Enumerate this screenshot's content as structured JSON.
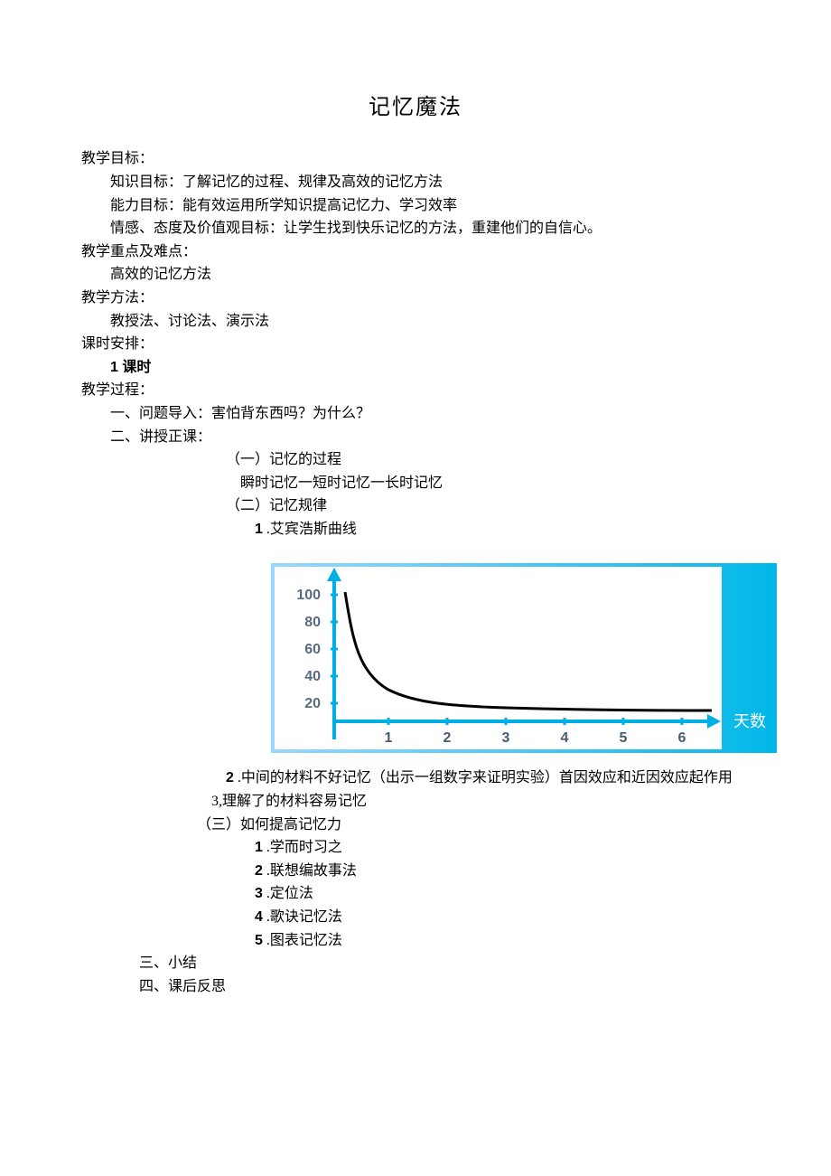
{
  "title": "记忆魔法",
  "goals_header": "教学目标：",
  "goals": {
    "knowledge": "知识目标：了解记忆的过程、规律及高效的记忆方法",
    "ability": "能力目标：能有效运用所学知识提高记忆力、学习效率",
    "emotion": "情感、态度及价值观目标：让学生找到快乐记忆的方法，重建他们的自信心。"
  },
  "focus_header": "教学重点及难点：",
  "focus_text": "高效的记忆方法",
  "method_header": "教学方法：",
  "method_text": "教授法、讨论法、演示法",
  "schedule_header": "课时安排：",
  "schedule_text": "1 课时",
  "process_header": "教学过程：",
  "sec1": "一、问题导入：害怕背东西吗？为什么？",
  "sec2": "二、讲授正课：",
  "s2_1": "（一）记忆的过程",
  "s2_1_text": "瞬时记忆一短时记忆一长时记忆",
  "s2_2": "（二）记忆规律",
  "s2_2_1_num": "1",
  "s2_2_1_text": " .艾宾浩斯曲线",
  "chart_data": {
    "type": "line",
    "title": "",
    "xlabel": "天数",
    "ylabel": "",
    "x": [
      0,
      1,
      2,
      3,
      4,
      5,
      6
    ],
    "values": [
      100,
      34,
      25,
      22,
      20,
      18,
      17
    ],
    "yticks": [
      20,
      40,
      60,
      80,
      100
    ],
    "xticks": [
      1,
      2,
      3,
      4,
      5,
      6
    ],
    "ylim": [
      0,
      110
    ]
  },
  "s2_2_2_num": "2",
  "s2_2_2_text": " .中间的材料不好记忆（出示一组数字来证明实验）首因效应和近因效应起作用",
  "s2_2_3": "3,理解了的材料容易记忆",
  "s2_3": "（三）如何提高记忆力",
  "methods_num": [
    "1",
    "2",
    "3",
    "4",
    "5"
  ],
  "methods_text": [
    " .学而时习之",
    " .联想编故事法",
    " .定位法",
    " .歌诀记忆法",
    " .图表记忆法"
  ],
  "sec3": "三、小结",
  "sec4": "四、课后反思"
}
